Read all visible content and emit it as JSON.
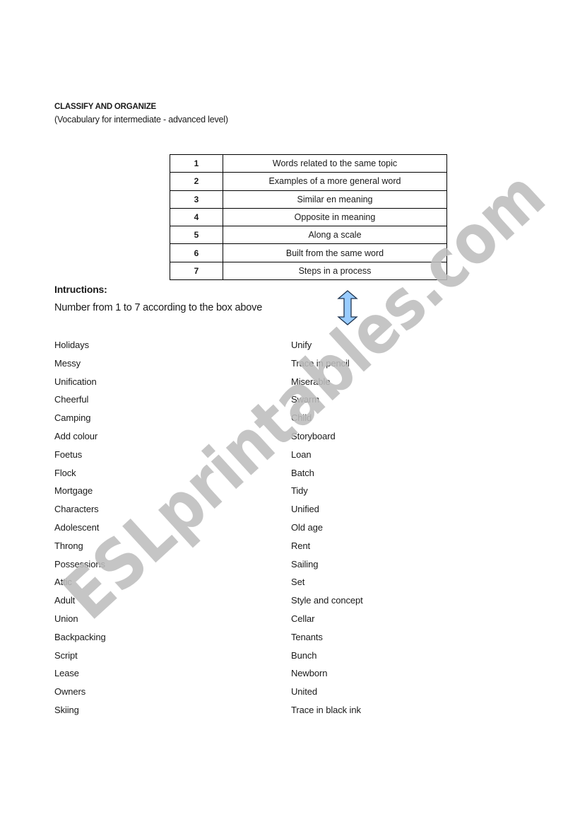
{
  "header": {
    "title": "CLASSIFY AND ORGANIZE",
    "subtitle": "(Vocabulary for intermediate - advanced level)"
  },
  "legend": [
    {
      "number": "1",
      "label": "Words related to the same topic"
    },
    {
      "number": "2",
      "label": "Examples of a more general word"
    },
    {
      "number": "3",
      "label": "Similar en meaning"
    },
    {
      "number": "4",
      "label": "Opposite in meaning"
    },
    {
      "number": "5",
      "label": "Along a scale"
    },
    {
      "number": "6",
      "label": "Built from the same word"
    },
    {
      "number": "7",
      "label": "Steps in a process"
    }
  ],
  "instructions": {
    "heading": "Intructions:",
    "text": "Number from 1 to 7 according to the box above",
    "icon": "double-arrow-vertical-icon",
    "icon_color": "#99ccff"
  },
  "words": {
    "left": [
      "Holidays",
      "Messy",
      "Unification",
      "Cheerful",
      "Camping",
      "Add colour",
      "Foetus",
      "Flock",
      "Mortgage",
      "Characters",
      "Adolescent",
      "Throng",
      "Possessions",
      "Attic",
      "Adult",
      "Union",
      "Backpacking",
      "Script",
      "Lease",
      "Owners",
      "Skiing"
    ],
    "right": [
      "Unify",
      "Trace in pencil",
      "Miserable",
      "Swarm",
      "Child",
      "Storyboard",
      "Loan",
      "Batch",
      "Tidy",
      "Unified",
      "Old age",
      "Rent",
      "Sailing",
      "Set",
      "Style and concept",
      "Cellar",
      "Tenants",
      "Bunch",
      "Newborn",
      "United",
      "Trace in black ink"
    ]
  },
  "watermark": {
    "text": "ESLprintables.com",
    "color": "#bdbdbd"
  }
}
